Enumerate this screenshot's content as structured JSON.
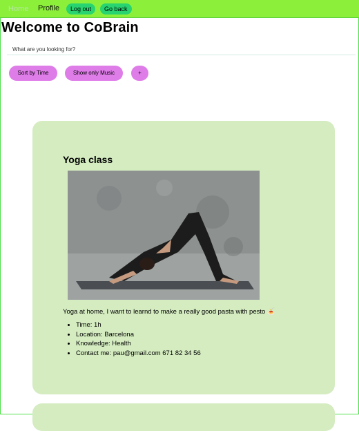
{
  "nav": {
    "home": "Home",
    "profile": "Profile",
    "logout": "Log out",
    "goback": "Go back"
  },
  "page": {
    "title": "Welcome to CoBrain"
  },
  "search": {
    "placeholder": "What are you looking for?"
  },
  "filters": {
    "sort_time": "Sort by Time",
    "show_music": "Show only Music",
    "add": "+"
  },
  "card": {
    "title": "Yoga class",
    "description": "Yoga at home, I want to learnd to make a really good pasta with pesto",
    "emoji": "🍝",
    "details": [
      "Time: 1h",
      "Location: Barcelona",
      "Knowledge: Health",
      "Contact me: pau@gmail.com 671 82 34 56"
    ]
  },
  "colors": {
    "nav_bg": "#8cf03a",
    "pill_green": "#27d46f",
    "button_purple": "#de7ce8",
    "card_bg": "#d4ecc0"
  }
}
